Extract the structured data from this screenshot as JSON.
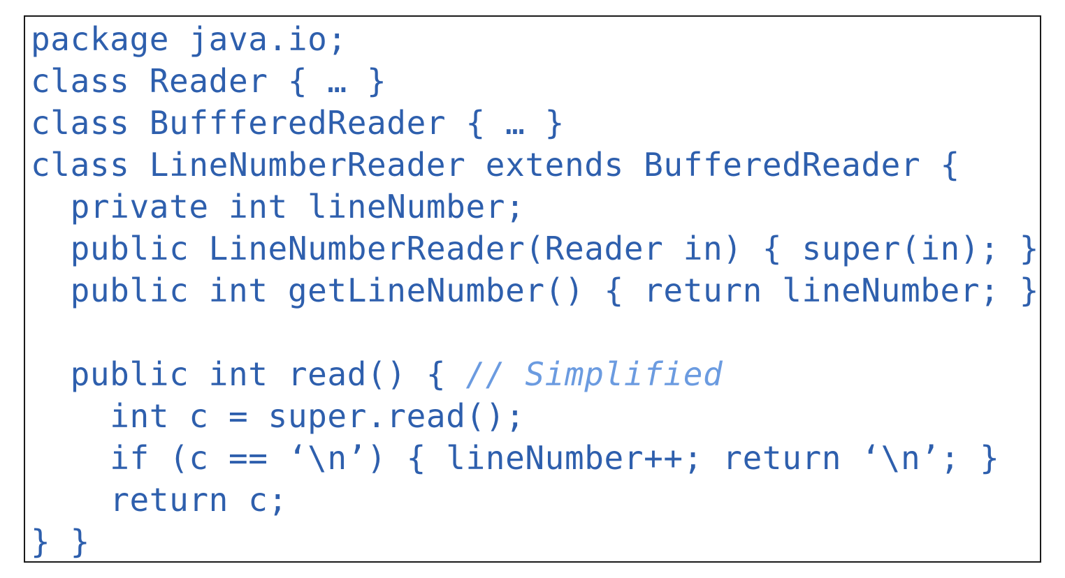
{
  "code": {
    "lines": [
      {
        "indent": "",
        "text": "package java.io;",
        "comment": ""
      },
      {
        "indent": "",
        "text": "class Reader { … }",
        "comment": ""
      },
      {
        "indent": "",
        "text": "class BuffferedReader { … }",
        "comment": ""
      },
      {
        "indent": "",
        "text": "class LineNumberReader extends BufferedReader {",
        "comment": ""
      },
      {
        "indent": "  ",
        "text": "private int lineNumber;",
        "comment": ""
      },
      {
        "indent": "  ",
        "text": "public LineNumberReader(Reader in) { super(in); }",
        "comment": ""
      },
      {
        "indent": "  ",
        "text": "public int getLineNumber() { return lineNumber; }",
        "comment": ""
      },
      {
        "indent": "",
        "text": "",
        "comment": ""
      },
      {
        "indent": "  ",
        "text": "public int read() { ",
        "comment": "// Simplified"
      },
      {
        "indent": "    ",
        "text": "int c = super.read();",
        "comment": ""
      },
      {
        "indent": "    ",
        "text": "if (c == ‘\\n’) { lineNumber++; return ‘\\n’; }",
        "comment": ""
      },
      {
        "indent": "    ",
        "text": "return c;",
        "comment": ""
      },
      {
        "indent": "",
        "text": "} }",
        "comment": ""
      }
    ]
  },
  "colors": {
    "code_text": "#2e5fad",
    "comment_text": "#6b9be0",
    "border": "#1a1a1a",
    "background": "#ffffff"
  }
}
